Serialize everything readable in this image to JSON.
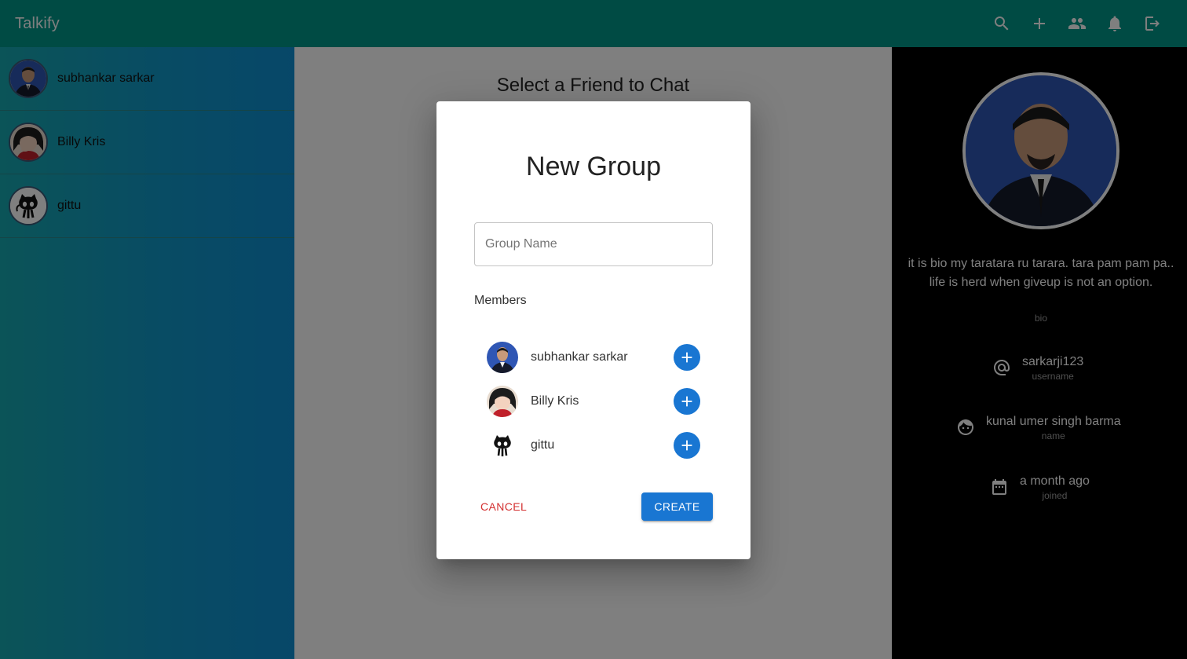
{
  "app": {
    "brand": "Talkify",
    "header_color": "#009688"
  },
  "toolbar": {
    "icons": [
      "search-icon",
      "add-icon",
      "group-icon",
      "notifications-icon",
      "logout-icon"
    ]
  },
  "sidebar": {
    "chats": [
      {
        "name": "subhankar sarkar",
        "avatar": "person-portrait-avatar"
      },
      {
        "name": "Billy Kris",
        "avatar": "anime-girl-avatar"
      },
      {
        "name": "gittu",
        "avatar": "octocat-avatar"
      }
    ]
  },
  "center": {
    "title": "Select a Friend to Chat"
  },
  "profile": {
    "bio": "it is bio my taratara ru tarara. tara pam pam pa.. life is herd when giveup is not an option.",
    "bio_caption": "bio",
    "username": "sarkarji123",
    "username_caption": "username",
    "name": "kunal umer singh barma",
    "name_caption": "name",
    "joined": "a month ago",
    "joined_caption": "joined"
  },
  "dialog": {
    "title": "New Group",
    "group_name_placeholder": "Group Name",
    "group_name_value": "",
    "members_label": "Members",
    "members": [
      {
        "name": "subhankar sarkar",
        "avatar": "person-portrait-avatar"
      },
      {
        "name": "Billy Kris",
        "avatar": "anime-girl-avatar"
      },
      {
        "name": "gittu",
        "avatar": "octocat-avatar"
      }
    ],
    "cancel_label": "CANCEL",
    "create_label": "CREATE",
    "accent_color": "#1976d2",
    "cancel_color": "#d32f2f"
  }
}
